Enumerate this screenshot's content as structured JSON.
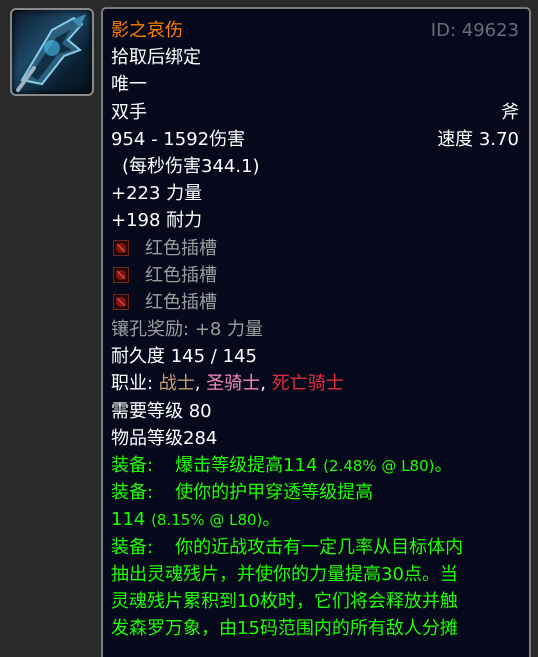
{
  "item": {
    "name": "影之哀伤",
    "id_label": "ID: 49623",
    "binding": "拾取后绑定",
    "unique": "唯一",
    "slot": "双手",
    "type": "斧",
    "damage": "954 - 1592伤害",
    "speed": "速度 3.70",
    "dps": "(每秒伤害344.1)",
    "stats": [
      "+223 力量",
      "+198 耐力"
    ],
    "sockets": [
      "红色插槽",
      "红色插槽",
      "红色插槽"
    ],
    "socket_bonus": "镶孔奖励: +8 力量",
    "durability": "耐久度 145 / 145",
    "class_label": "职业: ",
    "classes": [
      "战士",
      "圣骑士",
      "死亡骑士"
    ],
    "class_sep": ", ",
    "req_level": "需要等级 80",
    "item_level": "物品等级284",
    "equip": {
      "label": "装备:",
      "e1_text": "爆击等级提高114 ",
      "e1_pct": "(2.48% @ L80)",
      "e1_end": "。",
      "e2_line1": "使你的护甲穿透等级提高",
      "e2_line2": "114 ",
      "e2_pct": "(8.15% @ L80)",
      "e2_end": "。",
      "e3_line1": "你的近战攻击有一定几率从目标体内",
      "e3_line2": "抽出灵魂残片，并使你的力量提高30点。当",
      "e3_line3": "灵魂残片累积到10枚时，它们将会释放并触",
      "e3_line4": "发森罗万象，由15码范围内的所有敌人分摊"
    }
  },
  "colors": {
    "legendary": "#ff8000",
    "equip_green": "#1eff00",
    "warrior": "#c79c6e",
    "paladin": "#f58cba",
    "death_knight": "#e03040"
  },
  "icons": {
    "item": "shadowmourne-axe-icon",
    "socket": "red-socket-icon"
  }
}
